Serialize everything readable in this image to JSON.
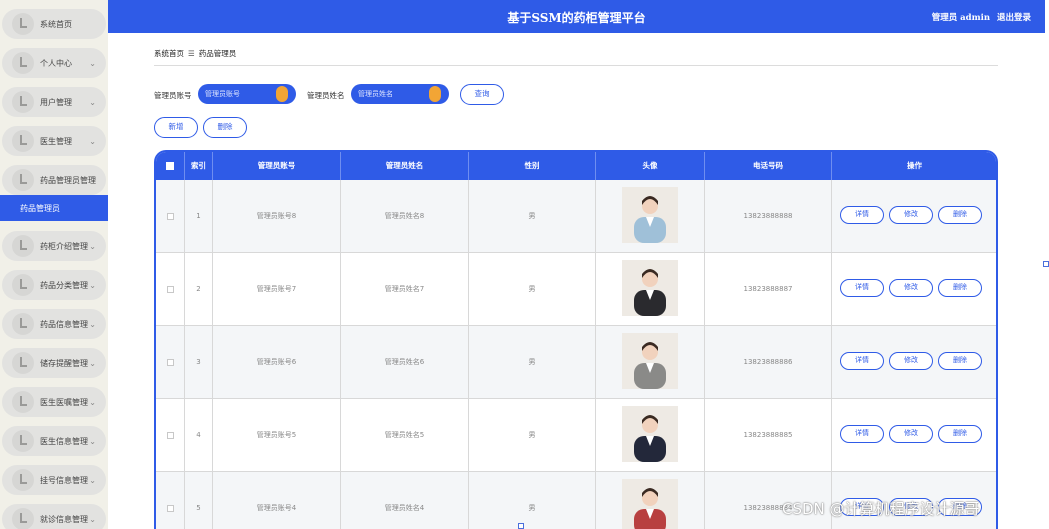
{
  "header": {
    "title": "基于SSM的药柜管理平台",
    "user_label": "管理员 admin",
    "logout": "退出登录"
  },
  "sidebar": {
    "items": [
      {
        "label": "系统首页",
        "chev": ""
      },
      {
        "label": "个人中心",
        "chev": "⌄"
      },
      {
        "label": "用户管理",
        "chev": "⌄"
      },
      {
        "label": "医生管理",
        "chev": "⌄"
      },
      {
        "label": "药品管理员管理",
        "chev": "⌃"
      },
      {
        "label": "药柜介绍管理",
        "chev": "⌄"
      },
      {
        "label": "药品分类管理",
        "chev": "⌄"
      },
      {
        "label": "药品信息管理",
        "chev": "⌄"
      },
      {
        "label": "储存提醒管理",
        "chev": "⌄"
      },
      {
        "label": "医生医嘱管理",
        "chev": "⌄"
      },
      {
        "label": "医生信息管理",
        "chev": "⌄"
      },
      {
        "label": "挂号信息管理",
        "chev": "⌄"
      },
      {
        "label": "就诊信息管理",
        "chev": "⌄"
      }
    ],
    "active_sub": "药品管理员"
  },
  "breadcrumb": {
    "home": "系统首页",
    "sep": "☰",
    "current": "药品管理员"
  },
  "search": {
    "label1": "管理员账号",
    "placeholder1": "管理员账号",
    "label2": "管理员姓名",
    "placeholder2": "管理员姓名",
    "query": "查询"
  },
  "actions": {
    "add": "新增",
    "delete": "删除"
  },
  "table": {
    "columns": [
      "",
      "索引",
      "管理员账号",
      "管理员姓名",
      "性别",
      "头像",
      "电话号码",
      "操作"
    ],
    "ops": [
      "详情",
      "修改",
      "删除"
    ],
    "rows": [
      {
        "index": "1",
        "account": "管理员账号8",
        "name": "管理员姓名8",
        "gender": "男",
        "phone": "13823888888",
        "avatar_color": "#9fc0d8"
      },
      {
        "index": "2",
        "account": "管理员账号7",
        "name": "管理员姓名7",
        "gender": "男",
        "phone": "13823888887",
        "avatar_color": "#2a2a2e"
      },
      {
        "index": "3",
        "account": "管理员账号6",
        "name": "管理员姓名6",
        "gender": "男",
        "phone": "13823888886",
        "avatar_color": "#8a8a88"
      },
      {
        "index": "4",
        "account": "管理员账号5",
        "name": "管理员姓名5",
        "gender": "男",
        "phone": "13823888885",
        "avatar_color": "#23283a"
      },
      {
        "index": "5",
        "account": "管理员账号4",
        "name": "管理员姓名4",
        "gender": "男",
        "phone": "13823888884",
        "avatar_color": "#b84040"
      }
    ]
  },
  "watermark": "CSDN @计算机程序设计源哥"
}
